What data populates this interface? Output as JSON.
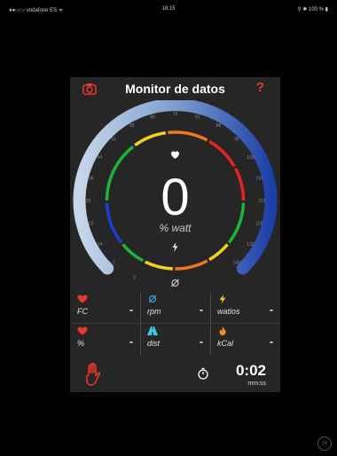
{
  "statusbar": {
    "carrier": "●●○○○ vodafone ES ᯤ",
    "time": "18:15",
    "battery": "⚲ ✱ 100 % ▮"
  },
  "header": {
    "title": "Monitor de datos",
    "help": "?",
    "camera_icon": "camera-icon"
  },
  "gauge": {
    "value": "0",
    "unit": "% watt",
    "ticks": [
      "7",
      "14",
      "22",
      "29",
      "36",
      "44",
      "51",
      "58",
      "66",
      "73",
      "81",
      "88",
      "95",
      "103",
      "110",
      "117",
      "125",
      "132",
      "140",
      "3"
    ]
  },
  "metrics": [
    {
      "label": "FC",
      "value": "-",
      "icon": "heart-icon",
      "color": "#e8392b"
    },
    {
      "label": "rpm",
      "value": "-",
      "icon": "cadence-icon",
      "color": "#3aa0e8"
    },
    {
      "label": "watios",
      "value": "-",
      "icon": "bolt-icon",
      "color": "#f2c12e"
    },
    {
      "label": "%",
      "value": "-",
      "icon": "heart-icon",
      "color": "#e8392b"
    },
    {
      "label": "dist",
      "value": "-",
      "icon": "road-icon",
      "color": "#3ec8f0"
    },
    {
      "label": "kCal",
      "value": "-",
      "icon": "flame-icon",
      "color": "#f28c1e"
    }
  ],
  "footer": {
    "time": "0:02",
    "time_unit": "mm:ss"
  },
  "zoom": "1X"
}
